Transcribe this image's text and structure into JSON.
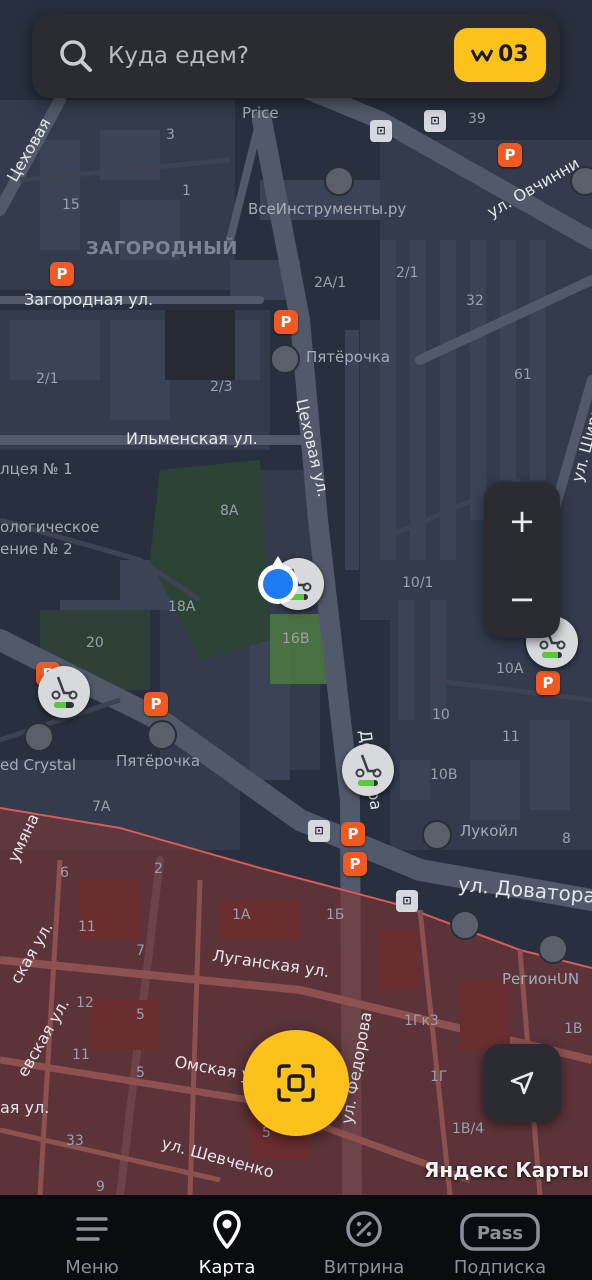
{
  "search": {
    "placeholder": "Куда едем?",
    "badge_value": "03",
    "icon": "search-icon",
    "badge_icon": "wallet-points-icon"
  },
  "zoom": {
    "plus": "+",
    "minus": "−"
  },
  "map": {
    "attribution": "Яндекс Карты",
    "district": "ЗАГОРОДНЫЙ",
    "restricted_zone_color": "#7a3536",
    "streets": [
      "ул. Овчинни",
      "Цеховая ул.",
      "Ильменская ул.",
      "Загородная ул.",
      "ул. Доватора",
      "Луганская ул.",
      "Омская ул.",
      "ул. Шевченко",
      "ул. Федорова",
      "ул. Ширшова",
      "Доватора",
      "Цеховая",
      "умяна",
      "ская ул.",
      "евская ул.",
      "ая ул.",
      "ченко"
    ],
    "places": [
      "Price",
      "ВсеИнструменты.ру",
      "Пятёрочка",
      "Пятёрочка",
      "ed Crystal",
      "Лукойл",
      "РегионUN",
      "лцея № 1",
      "ологическое",
      "ение № 2"
    ],
    "house_numbers": [
      "3",
      "1",
      "15",
      "2А/1",
      "2/1",
      "39",
      "32",
      "61",
      "2/1",
      "2/3",
      "8А",
      "18А",
      "16В",
      "20",
      "7А",
      "10/1",
      "10А",
      "10",
      "11",
      "10В",
      "8",
      "6",
      "2",
      "11",
      "1А",
      "1Б",
      "7",
      "12",
      "5",
      "11",
      "5",
      "1Гк3",
      "1Г",
      "1В",
      "1В/4",
      "33",
      "5",
      "9"
    ]
  },
  "nav": {
    "items": [
      {
        "label": "Меню",
        "icon": "menu-icon",
        "active": false
      },
      {
        "label": "Карта",
        "icon": "map-pin-icon",
        "active": true
      },
      {
        "label": "Витрина",
        "icon": "percent-icon",
        "active": false
      },
      {
        "label": "Подписка",
        "icon": "pass-icon",
        "active": false
      }
    ]
  },
  "colors": {
    "accent": "#fcc21b",
    "parking": "#f05a22",
    "battery": "#5bc93d",
    "user_location": "#1e7bf2"
  }
}
